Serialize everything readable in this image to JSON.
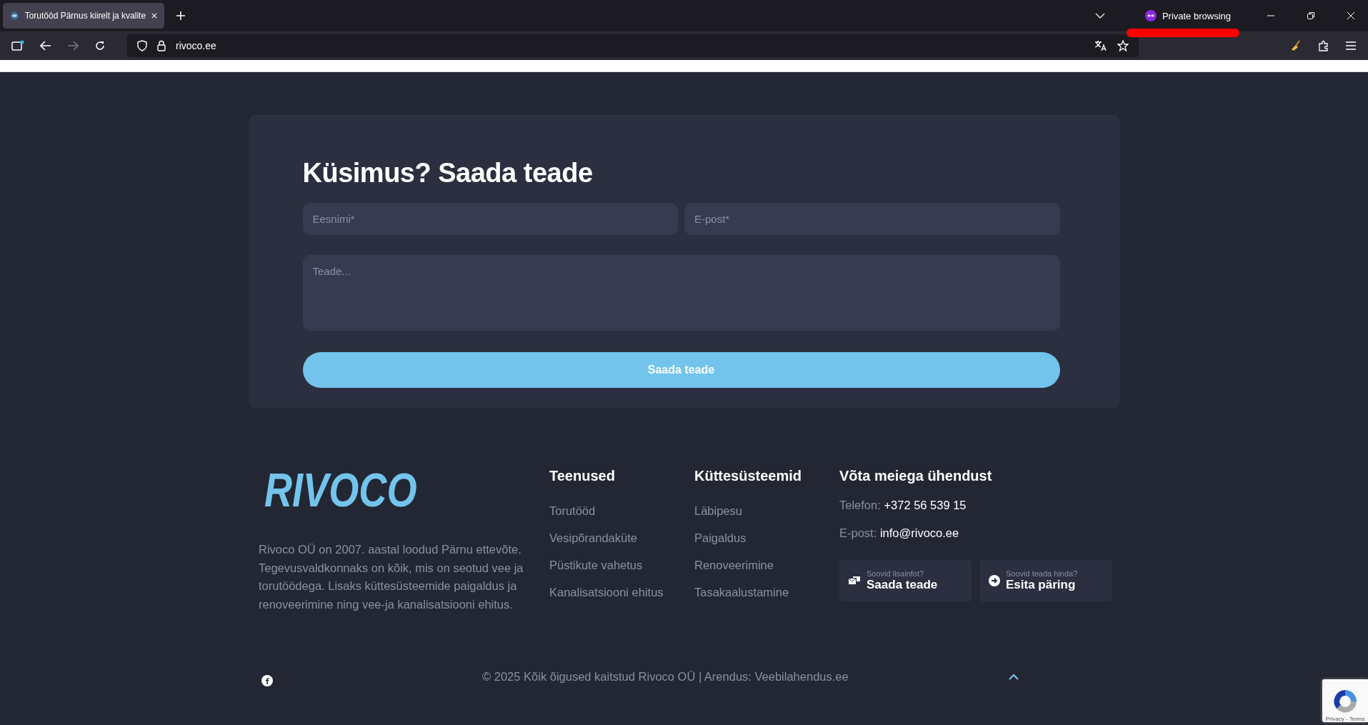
{
  "browser": {
    "tab_title": "Torutööd Pärnus kiirelt ja kvalite",
    "private_label": "Private browsing",
    "url": "rivoco.ee"
  },
  "contact_form": {
    "title": "Küsimus? Saada teade",
    "fields": [
      {
        "kind": "input",
        "placeholder": "Eesnimi*"
      },
      {
        "kind": "input",
        "placeholder": "E-post*"
      },
      {
        "kind": "textarea",
        "placeholder": "Teade..."
      }
    ],
    "submit": "Saada teade"
  },
  "footer": {
    "logo": "RIVOCO",
    "description": "Rivoco OÜ on 2007. aastal loodud Pärnu ettevõte. Tegevusvaldkonnaks on kõik, mis on seotud vee ja torutöödega. Lisaks küttesüsteemide paigaldus ja renoveerimine ning vee-ja kanalisatsiooni ehitus.",
    "columns": [
      {
        "title": "Teenused",
        "links": [
          "Torutööd",
          "Vesipõrandaküte",
          "Püstikute vahetus",
          "Kanalisatsiooni ehitus"
        ]
      },
      {
        "title": "Küttesüsteemid",
        "links": [
          "Läbipesu",
          "Paigaldus",
          "Renoveerimine",
          "Tasakaalustamine"
        ]
      }
    ],
    "contact": {
      "title": "Võta meiega ühendust",
      "lines": [
        {
          "label": "Telefon:",
          "value": "+372 56 539 15"
        },
        {
          "label": "E-post:",
          "value": "info@rivoco.ee"
        }
      ],
      "buttons": [
        {
          "kind": "message",
          "hint": "Soovid lisainfot?",
          "label": "Saada teade"
        },
        {
          "kind": "arrow",
          "hint": "Soovid teada hinda?",
          "label": "Esita päring"
        }
      ]
    },
    "copyright": "© 2025 Kõik õigused kaitstud Rivoco OÜ | Arendus: Veebilahendus.ee",
    "recaptcha": "Privacy - Terms"
  }
}
